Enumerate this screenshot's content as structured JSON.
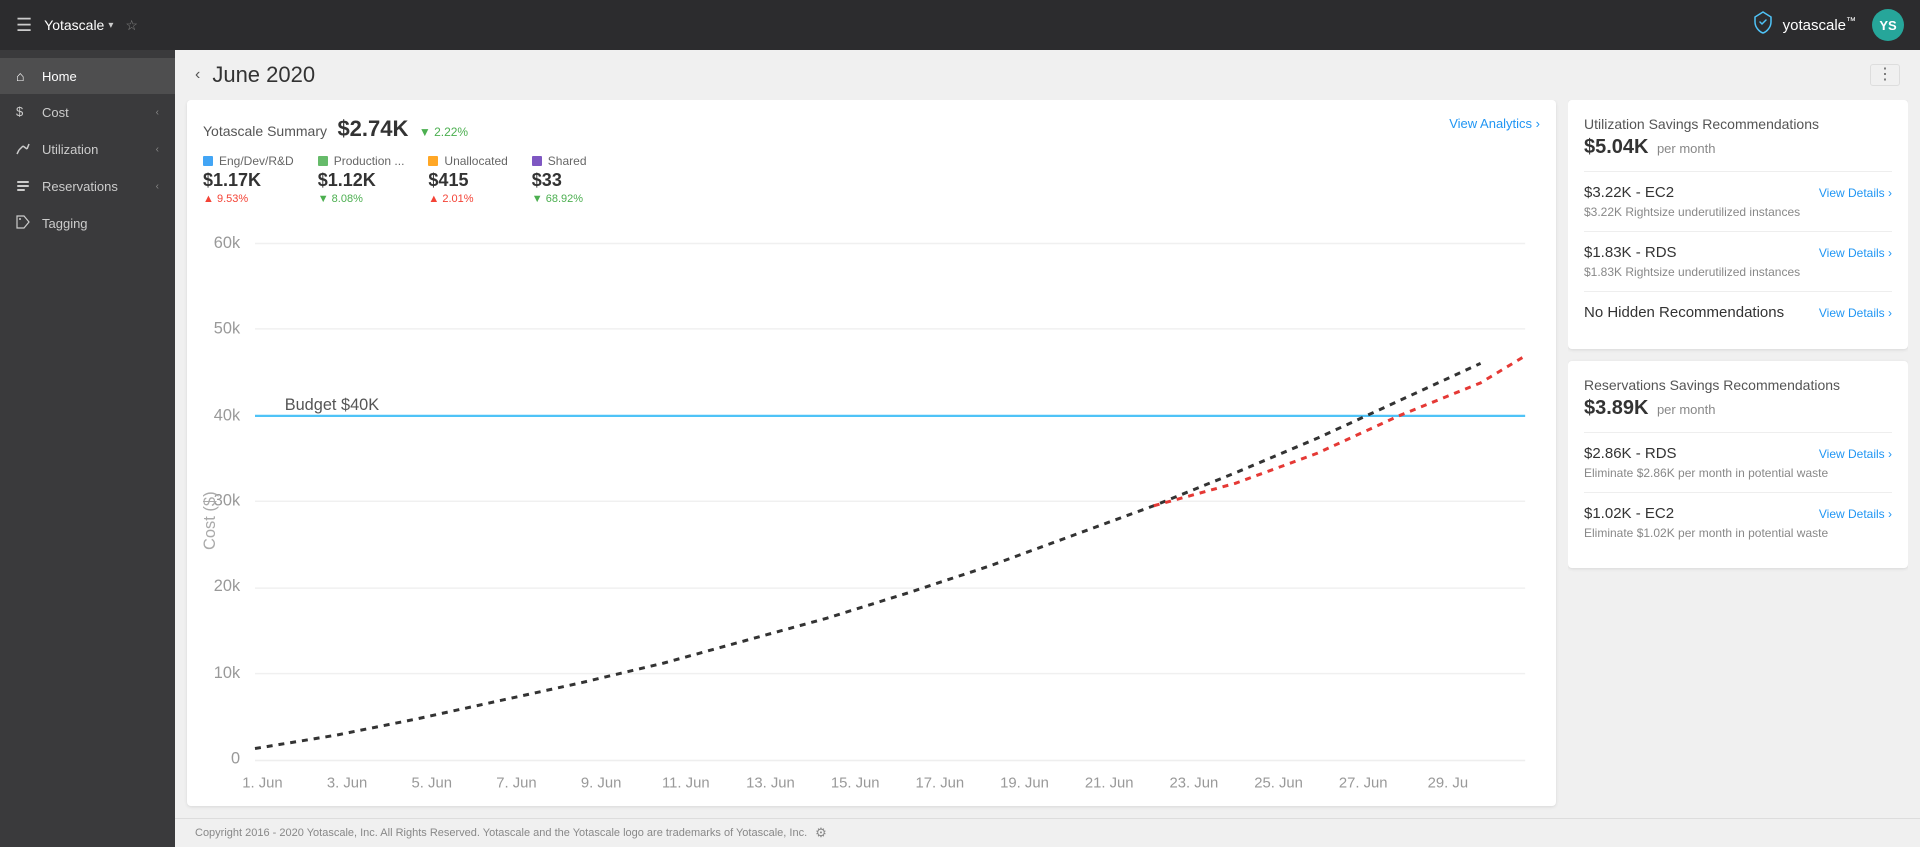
{
  "navbar": {
    "brand": "Yotascale",
    "logo_text": "yotascale",
    "logo_tm": "™",
    "avatar_initials": "YS"
  },
  "sidebar": {
    "items": [
      {
        "id": "home",
        "label": "Home",
        "icon": "⌂",
        "active": true
      },
      {
        "id": "cost",
        "label": "Cost",
        "icon": "$",
        "active": false,
        "has_chevron": true
      },
      {
        "id": "utilization",
        "label": "Utilization",
        "icon": "◈",
        "active": false,
        "has_chevron": true
      },
      {
        "id": "reservations",
        "label": "Reservations",
        "icon": "☰",
        "active": false,
        "has_chevron": true
      },
      {
        "id": "tagging",
        "label": "Tagging",
        "icon": "⬡",
        "active": false
      }
    ]
  },
  "page": {
    "title": "June 2020",
    "back_label": "‹"
  },
  "summary": {
    "title": "Yotascale Summary",
    "amount": "$2.74K",
    "pct": "2.22%",
    "pct_direction": "down",
    "view_analytics_label": "View Analytics ›"
  },
  "legend": [
    {
      "id": "eng",
      "label": "Eng/Dev/R&D",
      "color": "#42a5f5",
      "value": "$1.17K",
      "pct": "9.53%",
      "pct_dir": "up"
    },
    {
      "id": "prod",
      "label": "Production ...",
      "color": "#66bb6a",
      "value": "$1.12K",
      "pct": "8.08%",
      "pct_dir": "down"
    },
    {
      "id": "unalloc",
      "label": "Unallocated",
      "color": "#ffa726",
      "value": "$415",
      "pct": "2.01%",
      "pct_dir": "up"
    },
    {
      "id": "shared",
      "label": "Shared",
      "color": "#7e57c2",
      "value": "$33",
      "pct": "68.92%",
      "pct_dir": "down"
    }
  ],
  "chart": {
    "y_labels": [
      "60k",
      "50k",
      "40k",
      "30k",
      "20k",
      "10k",
      "0"
    ],
    "x_labels": [
      "1. Jun",
      "3. Jun",
      "5. Jun",
      "7. Jun",
      "9. Jun",
      "11. Jun",
      "13. Jun",
      "15. Jun",
      "17. Jun",
      "19. Jun",
      "21. Jun",
      "23. Jun",
      "25. Jun",
      "27. Jun",
      "29. Ju"
    ],
    "budget_label": "Budget $40K"
  },
  "utilization_rec": {
    "title": "Utilization Savings Recommendations",
    "amount": "$5.04K",
    "per_month": "per month",
    "items": [
      {
        "title": "$3.22K - EC2",
        "desc": "$3.22K Rightsize underutilized instances",
        "view_label": "View Details ›"
      },
      {
        "title": "$1.83K - RDS",
        "desc": "$1.83K Rightsize underutilized instances",
        "view_label": "View Details ›"
      },
      {
        "title": "No Hidden Recommendations",
        "desc": "",
        "view_label": "View Details ›"
      }
    ]
  },
  "reservations_rec": {
    "title": "Reservations Savings Recommendations",
    "amount": "$3.89K",
    "per_month": "per month",
    "items": [
      {
        "title": "$2.86K - RDS",
        "desc": "Eliminate $2.86K per month in potential waste",
        "view_label": "View Details ›"
      },
      {
        "title": "$1.02K - EC2",
        "desc": "Eliminate $1.02K per month in potential waste",
        "view_label": "View Details ›"
      }
    ]
  },
  "footer": {
    "text": "Copyright 2016 - 2020 Yotascale, Inc. All Rights Reserved. Yotascale and the Yotascale logo are trademarks of Yotascale, Inc.",
    "settings_icon": "⚙"
  }
}
